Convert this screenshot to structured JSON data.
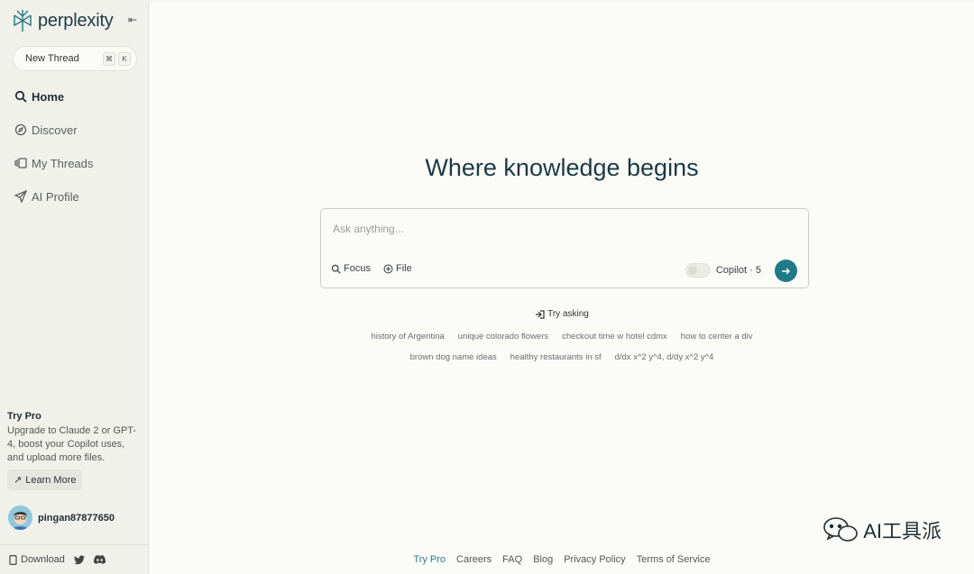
{
  "app": {
    "name": "perplexity"
  },
  "sidebar": {
    "new_thread": {
      "label": "New Thread",
      "keys": [
        "⌘",
        "K"
      ]
    },
    "items": [
      {
        "label": "Home",
        "icon": "search-icon",
        "active": true
      },
      {
        "label": "Discover",
        "icon": "compass-icon",
        "active": false
      },
      {
        "label": "My Threads",
        "icon": "threads-icon",
        "active": false
      },
      {
        "label": "AI Profile",
        "icon": "send-icon",
        "active": false
      }
    ],
    "promo": {
      "title": "Try Pro",
      "text": "Upgrade to Claude 2 or GPT-4, boost your Copilot uses, and upload more files.",
      "button": "Learn More"
    },
    "user": {
      "name": "pingan87877650"
    },
    "footer": {
      "download": "Download"
    }
  },
  "main": {
    "headline": "Where knowledge begins",
    "search": {
      "placeholder": "Ask anything...",
      "focus": "Focus",
      "file": "File",
      "copilot": "Copilot · 5"
    },
    "try_asking": "Try asking",
    "suggestions_row1": [
      "history of Argentina",
      "unique colorado flowers",
      "checkout time w hotel cdmx",
      "how to center a div"
    ],
    "suggestions_row2": [
      "brown dog name ideas",
      "healthy restaurants in sf",
      "d/dx x^2 y^4, d/dy x^2 y^4"
    ],
    "footer_links": [
      "Try Pro",
      "Careers",
      "FAQ",
      "Blog",
      "Privacy Policy",
      "Terms of Service"
    ]
  },
  "watermark": "AI工具派",
  "colors": {
    "accent": "#207b86",
    "brand": "#1f3a44",
    "sidebar_bg": "#f1f1ec",
    "main_bg": "#fbfbf8"
  }
}
